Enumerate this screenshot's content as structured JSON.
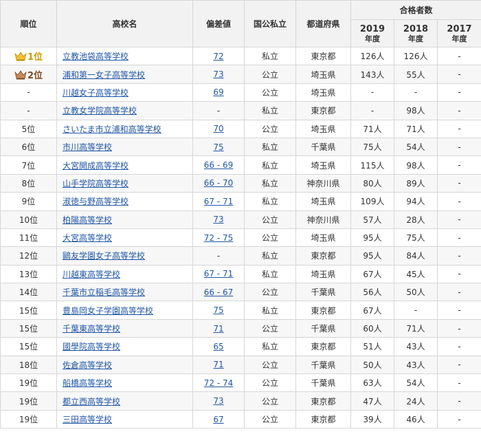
{
  "header": {
    "rank": "順位",
    "school": "高校名",
    "deviation": "偏差値",
    "type": "国公私立",
    "prefecture": "都道府県",
    "passers": "合格者数",
    "years": [
      {
        "year": "2019",
        "suffix": "年度"
      },
      {
        "year": "2018",
        "suffix": "年度"
      },
      {
        "year": "2017",
        "suffix": "年度"
      }
    ]
  },
  "rows": [
    {
      "rank": "1位",
      "crown": "gold",
      "school": "立教池袋高等学校",
      "deviation": "72",
      "type": "私立",
      "pref": "東京都",
      "y2019": "126人",
      "y2018": "126人",
      "y2017": "-"
    },
    {
      "rank": "2位",
      "crown": "silver",
      "school": "浦和第一女子高等学校",
      "deviation": "73",
      "type": "公立",
      "pref": "埼玉県",
      "y2019": "143人",
      "y2018": "55人",
      "y2017": "-"
    },
    {
      "rank": "-",
      "crown": "",
      "school": "川越女子高等学校",
      "deviation": "69",
      "type": "公立",
      "pref": "埼玉県",
      "y2019": "-",
      "y2018": "-",
      "y2017": "-"
    },
    {
      "rank": "-",
      "crown": "",
      "school": "立教女学院高等学校",
      "deviation": "-",
      "type": "私立",
      "pref": "東京都",
      "y2019": "-",
      "y2018": "98人",
      "y2017": "-"
    },
    {
      "rank": "5位",
      "crown": "",
      "school": "さいたま市立浦和高等学校",
      "deviation": "70",
      "type": "公立",
      "pref": "埼玉県",
      "y2019": "71人",
      "y2018": "71人",
      "y2017": "-"
    },
    {
      "rank": "6位",
      "crown": "",
      "school": "市川高等学校",
      "deviation": "75",
      "type": "私立",
      "pref": "千葉県",
      "y2019": "75人",
      "y2018": "54人",
      "y2017": "-"
    },
    {
      "rank": "7位",
      "crown": "",
      "school": "大宮開成高等学校",
      "deviation": "66 - 69",
      "type": "私立",
      "pref": "埼玉県",
      "y2019": "115人",
      "y2018": "98人",
      "y2017": "-"
    },
    {
      "rank": "8位",
      "crown": "",
      "school": "山手学院高等学校",
      "deviation": "66 - 70",
      "type": "私立",
      "pref": "神奈川県",
      "y2019": "80人",
      "y2018": "89人",
      "y2017": "-"
    },
    {
      "rank": "9位",
      "crown": "",
      "school": "淑徳与野高等学校",
      "deviation": "67 - 71",
      "type": "私立",
      "pref": "埼玉県",
      "y2019": "109人",
      "y2018": "94人",
      "y2017": "-"
    },
    {
      "rank": "10位",
      "crown": "",
      "school": "柏陽高等学校",
      "deviation": "73",
      "type": "公立",
      "pref": "神奈川県",
      "y2019": "57人",
      "y2018": "28人",
      "y2017": "-"
    },
    {
      "rank": "11位",
      "crown": "",
      "school": "大宮高等学校",
      "deviation": "72 - 75",
      "type": "公立",
      "pref": "埼玉県",
      "y2019": "95人",
      "y2018": "75人",
      "y2017": "-"
    },
    {
      "rank": "12位",
      "crown": "",
      "school": "鷗友学園女子高等学校",
      "deviation": "-",
      "type": "私立",
      "pref": "東京都",
      "y2019": "95人",
      "y2018": "84人",
      "y2017": "-"
    },
    {
      "rank": "13位",
      "crown": "",
      "school": "川越東高等学校",
      "deviation": "67 - 71",
      "type": "私立",
      "pref": "埼玉県",
      "y2019": "67人",
      "y2018": "45人",
      "y2017": "-"
    },
    {
      "rank": "14位",
      "crown": "",
      "school": "千葉市立稲毛高等学校",
      "deviation": "66 - 67",
      "type": "公立",
      "pref": "千葉県",
      "y2019": "56人",
      "y2018": "50人",
      "y2017": "-"
    },
    {
      "rank": "15位",
      "crown": "",
      "school": "豊島岡女子学園高等学校",
      "deviation": "75",
      "type": "私立",
      "pref": "東京都",
      "y2019": "67人",
      "y2018": "-",
      "y2017": "-"
    },
    {
      "rank": "15位",
      "crown": "",
      "school": "千葉東高等学校",
      "deviation": "71",
      "type": "公立",
      "pref": "千葉県",
      "y2019": "60人",
      "y2018": "71人",
      "y2017": "-"
    },
    {
      "rank": "15位",
      "crown": "",
      "school": "國學院高等学校",
      "deviation": "65",
      "type": "私立",
      "pref": "東京都",
      "y2019": "51人",
      "y2018": "43人",
      "y2017": "-"
    },
    {
      "rank": "18位",
      "crown": "",
      "school": "佐倉高等学校",
      "deviation": "71",
      "type": "公立",
      "pref": "千葉県",
      "y2019": "50人",
      "y2018": "43人",
      "y2017": "-"
    },
    {
      "rank": "19位",
      "crown": "",
      "school": "船橋高等学校",
      "deviation": "72 - 74",
      "type": "公立",
      "pref": "千葉県",
      "y2019": "63人",
      "y2018": "54人",
      "y2017": "-"
    },
    {
      "rank": "19位",
      "crown": "",
      "school": "都立西高等学校",
      "deviation": "73",
      "type": "公立",
      "pref": "東京都",
      "y2019": "47人",
      "y2018": "24人",
      "y2017": "-"
    },
    {
      "rank": "19位",
      "crown": "",
      "school": "三田高等学校",
      "deviation": "67",
      "type": "公立",
      "pref": "東京都",
      "y2019": "39人",
      "y2018": "46人",
      "y2017": "-"
    }
  ],
  "colors": {
    "link": "#2257a5",
    "gold": "#c89a00",
    "silver": "#7a4a20",
    "header_bg": "#f2f2f2",
    "border": "#d6d6d6"
  }
}
